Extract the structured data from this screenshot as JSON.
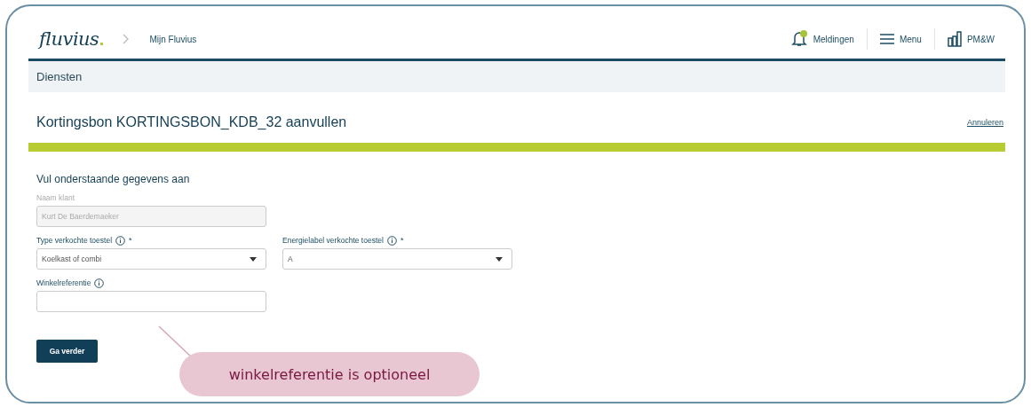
{
  "header": {
    "logo": "fluvius",
    "breadcrumb": "Mijn Fluvius",
    "actions": [
      {
        "kind": "bell",
        "label": "Meldingen"
      },
      {
        "kind": "menu",
        "label": "Menu"
      },
      {
        "kind": "building",
        "label": "PM&W"
      }
    ]
  },
  "section_bar": {
    "title": "Diensten"
  },
  "page": {
    "title": "Kortingsbon KORTINGSBON_KDB_32 aanvullen",
    "cancel_link": "Annuleren",
    "progress": {
      "level": 1
    }
  },
  "form": {
    "heading": "Vul onderstaande gegevens aan",
    "fields": [
      {
        "kind": "text",
        "label": "Naam klant",
        "value": "Kurt De Baerdemaeker",
        "disabled": true,
        "info": false
      },
      {
        "kind": "select",
        "label": "Type verkochte toestel",
        "value": "Koelkast of combi",
        "disabled": false,
        "info": true,
        "required_mark": "*"
      },
      {
        "kind": "select",
        "label": "Energielabel verkochte toestel",
        "value": "A",
        "disabled": false,
        "info": true,
        "required_mark": "*"
      },
      {
        "kind": "text",
        "label": "Winkelreferentie",
        "disabled": false,
        "info": true
      }
    ],
    "submit": "Ga verder"
  },
  "callout": {
    "text": "winkelreferentie is optioneel"
  }
}
